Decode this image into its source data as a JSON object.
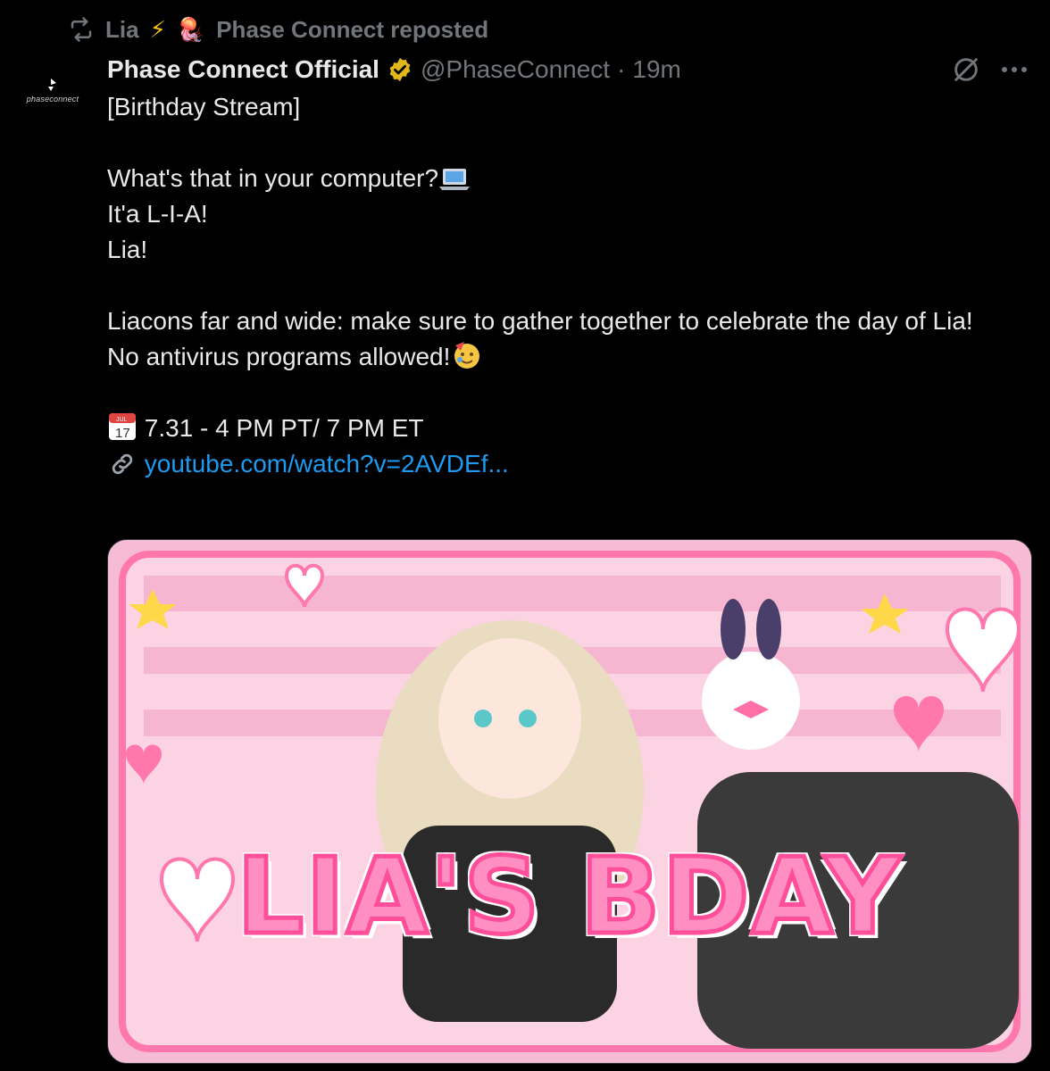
{
  "repost": {
    "reposter_name": "Lia",
    "reposter_emojis": [
      "⚡",
      "🪼"
    ],
    "label": "Phase Connect reposted"
  },
  "author": {
    "avatar_text": "phaseconnect",
    "display_name": "Phase Connect Official",
    "handle": "@PhaseConnect",
    "separator": "·",
    "time": "19m"
  },
  "post": {
    "line1": "[Birthday Stream]",
    "line2": "What's that in your computer?",
    "line2_emoji": "laptop-emoji",
    "line3": "It'a L-I-A!",
    "line4": "Lia!",
    "line5": "Liacons far and wide: make sure to gather together to celebrate the day of Lia!",
    "line6": "No antivirus programs allowed!",
    "line6_emoji": "partying-face-emoji",
    "schedule": "7.31 -  4 PM PT/ 7 PM ET",
    "calendar_month": "JUL",
    "calendar_day": "17",
    "link": "youtube.com/watch?v=2AVDEf..."
  },
  "media": {
    "banner_text": "LIA'S BDAY",
    "colors": {
      "pink": "#f6b9d2",
      "hot_pink": "#ff4f9a"
    }
  },
  "colors": {
    "background": "#000000",
    "text": "#e7e9ea",
    "muted": "#71767b",
    "link": "#1d9bf0",
    "verified": "#e2b719"
  }
}
